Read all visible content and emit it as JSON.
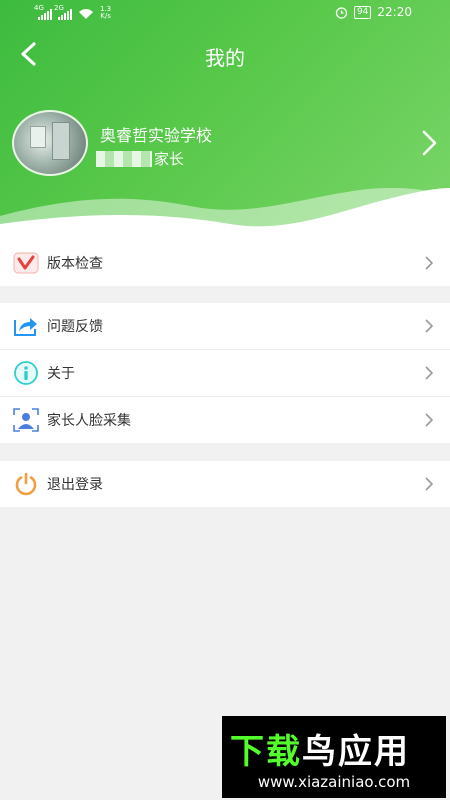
{
  "status_bar": {
    "signal1": "4G",
    "signal2": "2G",
    "speed_value": "1.3",
    "speed_unit": "K/s",
    "battery": "94",
    "time": "22:20"
  },
  "header": {
    "title": "我的"
  },
  "profile": {
    "school": "奥睿哲实验学校",
    "role": "家长"
  },
  "menu_groups": [
    [
      {
        "label": "版本检查",
        "icon": "version-check-icon"
      }
    ],
    [
      {
        "label": "问题反馈",
        "icon": "feedback-icon"
      },
      {
        "label": "关于",
        "icon": "info-icon"
      },
      {
        "label": "家长人脸采集",
        "icon": "face-capture-icon"
      }
    ],
    [
      {
        "label": "退出登录",
        "icon": "power-icon"
      }
    ]
  ],
  "colors": {
    "header_green": "#4cc24a",
    "version_red": "#e4433e",
    "feedback_blue": "#2196f3",
    "info_cyan": "#2ccfcf",
    "face_blue": "#4a7fe0",
    "logout_orange": "#f0a040"
  },
  "watermark": {
    "brand_a": "下载",
    "brand_b": "鸟应用",
    "url": "www.xiazainiao.com"
  }
}
